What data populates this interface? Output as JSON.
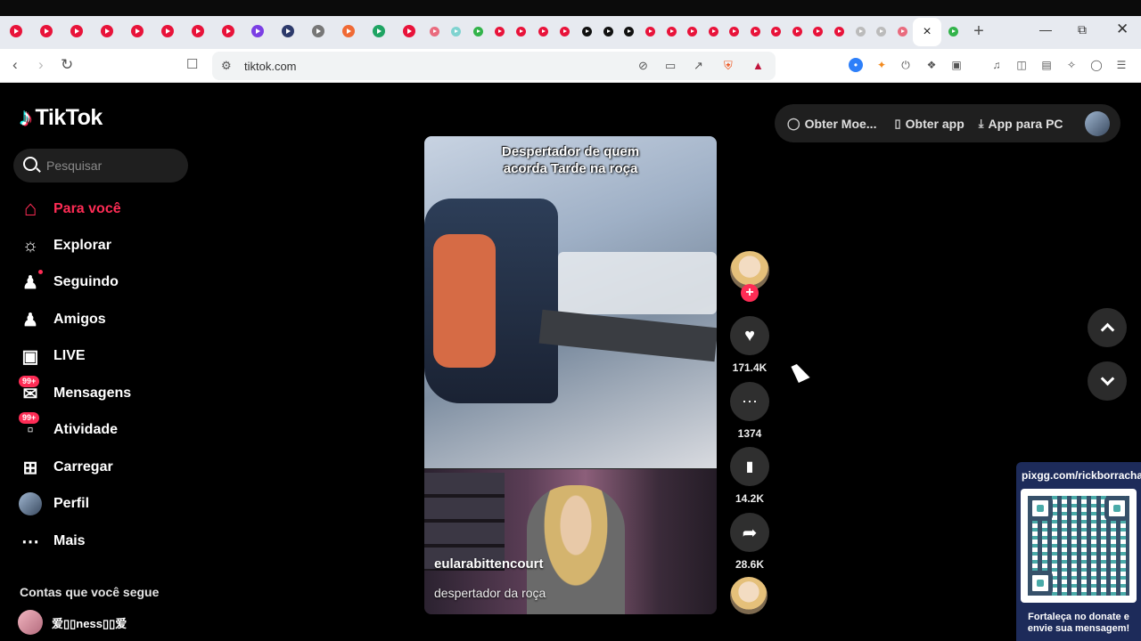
{
  "browser": {
    "active_tab_close": "×",
    "new_tab": "+",
    "url": "tiktok.com"
  },
  "sidebar": {
    "logo": "TikTok",
    "search_placeholder": "Pesquisar",
    "items": [
      {
        "label": "Para você",
        "icon": "home-icon"
      },
      {
        "label": "Explorar",
        "icon": "compass-icon"
      },
      {
        "label": "Seguindo",
        "icon": "following-icon"
      },
      {
        "label": "Amigos",
        "icon": "friends-icon"
      },
      {
        "label": "LIVE",
        "icon": "live-tv-icon"
      },
      {
        "label": "Mensagens",
        "icon": "messages-icon",
        "badge": "99+"
      },
      {
        "label": "Atividade",
        "icon": "activity-icon",
        "badge": "99+"
      },
      {
        "label": "Carregar",
        "icon": "upload-icon"
      },
      {
        "label": "Perfil",
        "icon": "profile-avatar"
      },
      {
        "label": "Mais",
        "icon": "more-icon"
      }
    ],
    "following_title": "Contas que você segue",
    "following_account": "爱▯▯ness▯▯爱"
  },
  "header": {
    "get_coins": "Obter Moe...",
    "get_app": "Obter app",
    "pc_app": "App para PC"
  },
  "video": {
    "caption_line1": "Despertador de quem",
    "caption_line2": "acorda Tarde na roça",
    "author": "eularabittencourt",
    "description": "despertador da roça"
  },
  "actions": {
    "likes": "171.4K",
    "comments": "1374",
    "saves": "14.2K",
    "shares": "28.6K"
  },
  "overlay": {
    "title": "pixgg.com/rickborracha",
    "footer": "Fortaleça no donate e envie sua mensagem!"
  },
  "colors": {
    "accent": "#fe2c55",
    "background": "#000000",
    "overlay_bg": "#1d2b5a"
  }
}
